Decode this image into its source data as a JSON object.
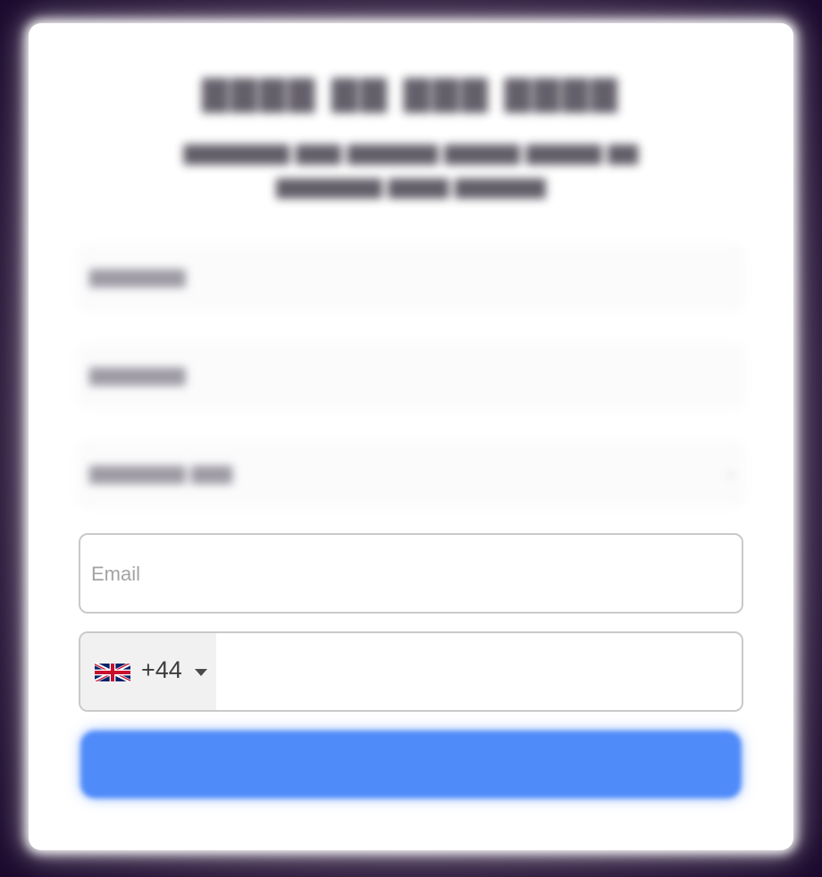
{
  "form": {
    "email": {
      "placeholder": "Email",
      "value": ""
    },
    "phone": {
      "country_flag": "uk-flag-icon",
      "dial_code": "+44",
      "value": ""
    }
  },
  "colors": {
    "submit_button": "#4f8bf9",
    "backdrop": "#1c0a2e"
  }
}
